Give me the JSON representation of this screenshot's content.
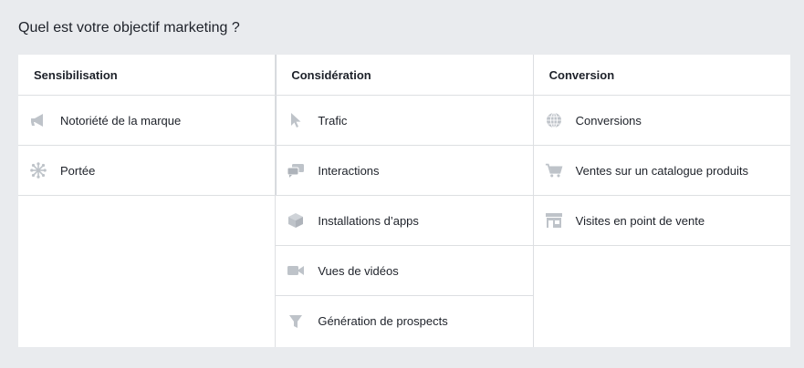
{
  "page": {
    "title": "Quel est votre objectif marketing ?"
  },
  "colors": {
    "background": "#e9ebee",
    "panel": "#ffffff",
    "divider": "#dddfe2",
    "icon": "#bec3c9",
    "text": "#1d2129"
  },
  "columns": [
    {
      "header": "Sensibilisation",
      "items": [
        {
          "label": "Notoriété de la marque",
          "icon": "megaphone-icon"
        },
        {
          "label": "Portée",
          "icon": "asterisk-icon"
        }
      ]
    },
    {
      "header": "Considération",
      "items": [
        {
          "label": "Trafic",
          "icon": "cursor-icon"
        },
        {
          "label": "Interactions",
          "icon": "chat-bubbles-icon"
        },
        {
          "label": "Installations d’apps",
          "icon": "box-icon"
        },
        {
          "label": "Vues de vidéos",
          "icon": "video-camera-icon"
        },
        {
          "label": "Génération de prospects",
          "icon": "funnel-icon"
        }
      ]
    },
    {
      "header": "Conversion",
      "items": [
        {
          "label": "Conversions",
          "icon": "globe-icon"
        },
        {
          "label": "Ventes sur un catalogue produits",
          "icon": "shopping-cart-icon"
        },
        {
          "label": "Visites en point de vente",
          "icon": "storefront-icon"
        }
      ]
    }
  ]
}
